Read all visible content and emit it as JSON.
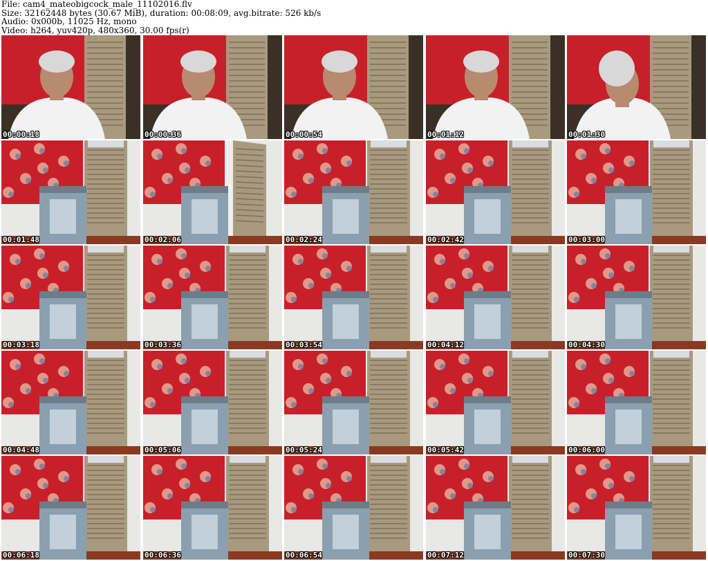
{
  "header": {
    "file_line": "File: cam4_mateobigcock_male_11102016.flv",
    "size_line": "Size: 32162448 bytes (30.67 MiB), duration: 00:08:09, avg.bitrate: 526 kb/s",
    "audio_line": "Audio: 0x000b, 11025 Hz, mono",
    "video_line": "Video: h264, yuv420p, 480x360, 30.00 fps(r)"
  },
  "thumbnails": [
    {
      "timestamp": "00:00:18",
      "scene": "person"
    },
    {
      "timestamp": "00:00:36",
      "scene": "person"
    },
    {
      "timestamp": "00:00:54",
      "scene": "person"
    },
    {
      "timestamp": "00:01:12",
      "scene": "person"
    },
    {
      "timestamp": "00:01:30",
      "scene": "person-down"
    },
    {
      "timestamp": "00:01:48",
      "scene": "room"
    },
    {
      "timestamp": "00:02:06",
      "scene": "room-door-open"
    },
    {
      "timestamp": "00:02:24",
      "scene": "room"
    },
    {
      "timestamp": "00:02:42",
      "scene": "room"
    },
    {
      "timestamp": "00:03:00",
      "scene": "room"
    },
    {
      "timestamp": "00:03:18",
      "scene": "room"
    },
    {
      "timestamp": "00:03:36",
      "scene": "room"
    },
    {
      "timestamp": "00:03:54",
      "scene": "room"
    },
    {
      "timestamp": "00:04:12",
      "scene": "room"
    },
    {
      "timestamp": "00:04:30",
      "scene": "room"
    },
    {
      "timestamp": "00:04:48",
      "scene": "room"
    },
    {
      "timestamp": "00:05:06",
      "scene": "room"
    },
    {
      "timestamp": "00:05:24",
      "scene": "room"
    },
    {
      "timestamp": "00:05:42",
      "scene": "room"
    },
    {
      "timestamp": "00:06:00",
      "scene": "room"
    },
    {
      "timestamp": "00:06:18",
      "scene": "room"
    },
    {
      "timestamp": "00:06:36",
      "scene": "room"
    },
    {
      "timestamp": "00:06:54",
      "scene": "room"
    },
    {
      "timestamp": "00:07:12",
      "scene": "room"
    },
    {
      "timestamp": "00:07:30",
      "scene": "room"
    }
  ],
  "colors": {
    "wallpaper": "#c8202a",
    "door": "#a89a7e",
    "wall": "#e8e8e6",
    "screen": "#8aa0b0",
    "shirt": "#f2f2f2",
    "hair": "#d8d8d8",
    "skin": "#b88a70"
  }
}
